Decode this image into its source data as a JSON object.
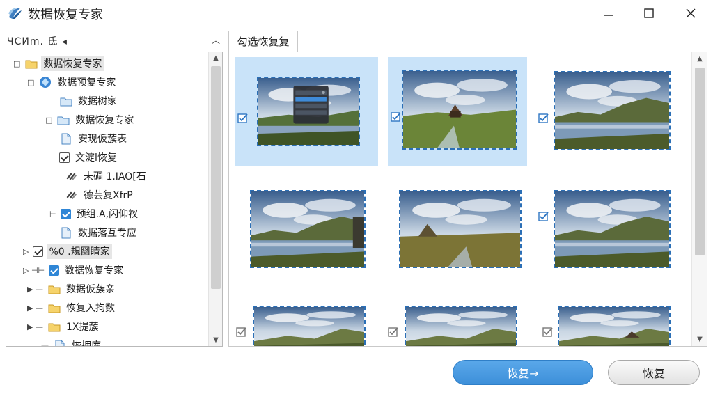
{
  "window": {
    "title": "数据恢复专家",
    "controls": [
      "minimize-icon",
      "maximize-icon",
      "close-icon"
    ]
  },
  "left_panel": {
    "header_label": "ЧCИm. 氐 ◂",
    "tree": [
      {
        "label": "数据恢复专家",
        "icon": "folder-icon",
        "expander": "□",
        "selected": true
      },
      {
        "label": "数据预复专家",
        "icon": "blue-gem-icon",
        "expander": "□"
      },
      {
        "label": "数据树家",
        "icon": "folder-blue-icon",
        "expander": ""
      },
      {
        "label": "数据恢复专家",
        "icon": "folder-blue-icon",
        "expander": "□"
      },
      {
        "label": "安现仮蔟表",
        "icon": "document-icon",
        "expander": ""
      },
      {
        "label": "文淀l恢复",
        "icon": "checkbox-checked-icon",
        "expander": ""
      },
      {
        "label": "未碉 1.IAO[石",
        "icon": "link-icon",
        "expander": ""
      },
      {
        "label": "德芸复XfrP",
        "icon": "link-icon",
        "expander": ""
      },
      {
        "label": "预组.A,闪仰衩",
        "icon": "checkbox-blue-icon",
        "expander": "⊢"
      },
      {
        "label": "数据落互专应",
        "icon": "document-icon",
        "expander": ""
      },
      {
        "label": "%0 .規圝睛家",
        "icon": "checkbox-dark-icon",
        "expander": "▷",
        "selected": true
      },
      {
        "label": "数据恢复专家",
        "icon": "checkbox-blue-icon",
        "expander": "▷ ⊣⊢"
      },
      {
        "label": "数据仮蔟亲",
        "icon": "folder-icon",
        "expander": "▶ —"
      },
      {
        "label": "恢复入拘数",
        "icon": "folder-icon",
        "expander": "▶ —"
      },
      {
        "label": "1X提蔟",
        "icon": "folder-icon",
        "expander": "▶ —"
      },
      {
        "label": "恢拥库",
        "icon": "document-icon",
        "expander": "—"
      }
    ]
  },
  "right_panel": {
    "tab_label": "勾选恢复复",
    "thumbnails": [
      {
        "scene": "landscape-with-dialog",
        "checked": true,
        "selected": true
      },
      {
        "scene": "hut-meadow",
        "checked": true,
        "selected": true
      },
      {
        "scene": "lake-mountains",
        "checked": true,
        "selected": false
      },
      {
        "scene": "lake-cloudy-reflection",
        "checked": false,
        "selected": false
      },
      {
        "scene": "pyramid-rock-field",
        "checked": false,
        "selected": false
      },
      {
        "scene": "lake-hills",
        "checked": true,
        "selected": false
      },
      {
        "scene": "sky-hills",
        "checked": true,
        "selected": false
      },
      {
        "scene": "sky-hills",
        "checked": true,
        "selected": false
      },
      {
        "scene": "sky-rock",
        "checked": true,
        "selected": false
      }
    ]
  },
  "buttons": {
    "primary_label": "恢复→",
    "secondary_label": "恢复"
  }
}
